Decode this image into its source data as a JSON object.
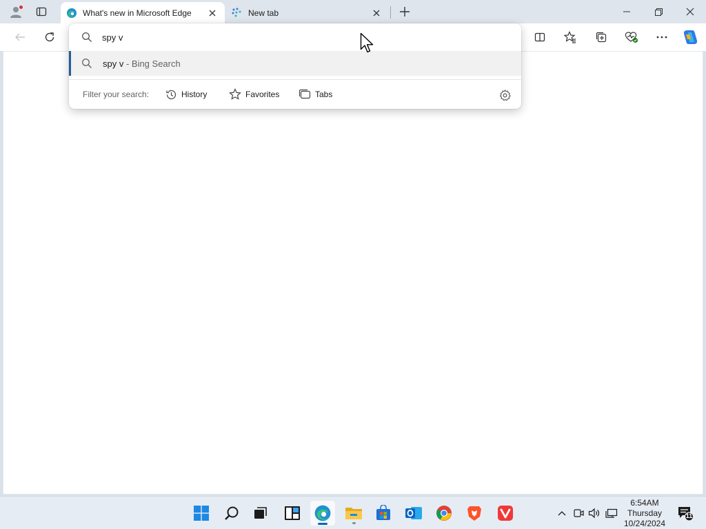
{
  "window": {
    "tabs": [
      {
        "title": "What's new in Microsoft Edge",
        "active": true,
        "icon": "edge-icon"
      },
      {
        "title": "New tab",
        "active": false,
        "icon": "newtab-icon"
      }
    ],
    "controls": [
      "minimize-icon",
      "restore-icon",
      "close-icon"
    ]
  },
  "toolbar": {
    "icons": [
      "back-icon",
      "refresh-icon",
      "split-screen-icon",
      "favorites-icon",
      "collections-icon",
      "browser-essentials-icon",
      "more-icon",
      "copilot-icon"
    ]
  },
  "omnibox": {
    "query": "spy v",
    "suggestion": {
      "main": "spy v",
      "sub": " - Bing Search"
    },
    "filter_label": "Filter your search:",
    "filters": [
      {
        "label": "History",
        "icon": "history-icon"
      },
      {
        "label": "Favorites",
        "icon": "star-icon"
      },
      {
        "label": "Tabs",
        "icon": "tabs-icon"
      }
    ]
  },
  "taskbar": {
    "apps": [
      "start-icon",
      "search-icon",
      "task-view-icon",
      "widgets-icon",
      "edge-icon",
      "file-explorer-icon",
      "store-icon",
      "outlook-icon",
      "chrome-icon",
      "brave-icon",
      "vivaldi-icon"
    ],
    "tray": [
      "chevron-up-icon",
      "meet-now-icon",
      "volume-icon",
      "network-icon"
    ],
    "clock": {
      "time": "6:54AM",
      "day": "Thursday",
      "date": "10/24/2024"
    },
    "notification_count": "11"
  },
  "colors": {
    "accent": "#0067c0",
    "tabstrip": "#dfe5ec",
    "suggestion_highlight": "#215b9a"
  }
}
